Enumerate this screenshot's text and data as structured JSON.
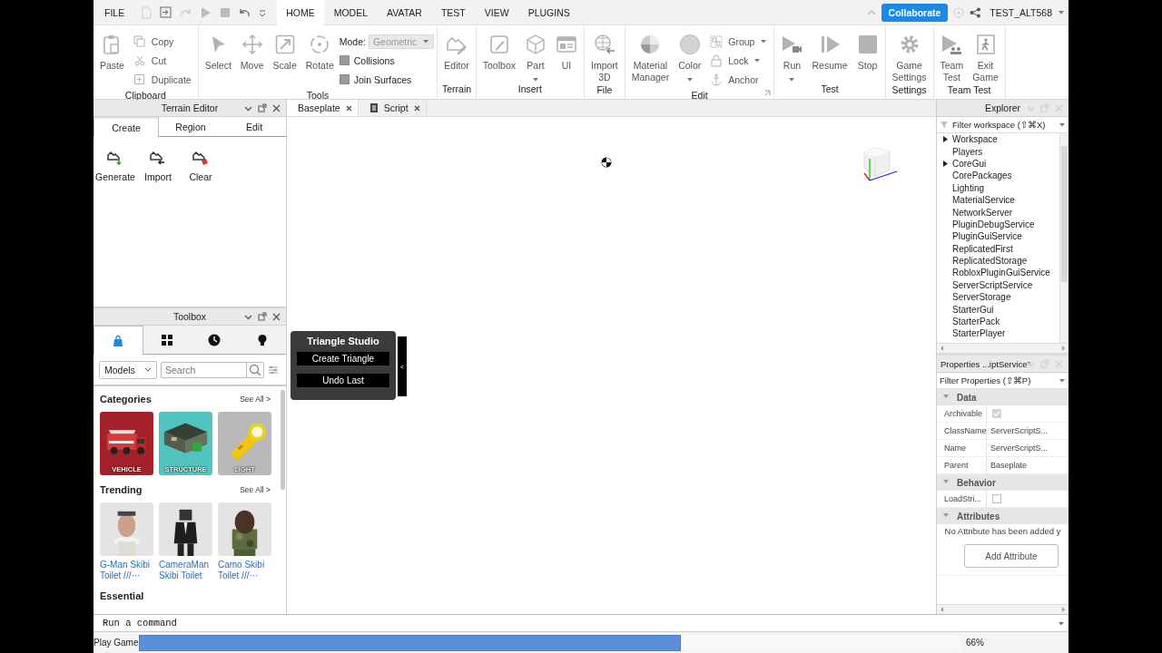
{
  "menu": {
    "file": "FILE",
    "tabs": [
      {
        "label": "HOME",
        "selected": true
      },
      {
        "label": "MODEL",
        "selected": false
      },
      {
        "label": "AVATAR",
        "selected": false
      },
      {
        "label": "TEST",
        "selected": false
      },
      {
        "label": "VIEW",
        "selected": false
      },
      {
        "label": "PLUGINS",
        "selected": false
      }
    ],
    "collaborate": "Collaborate",
    "user": "TEST_ALT568"
  },
  "ribbon": [
    {
      "label": "Clipboard",
      "launcher": false,
      "tools": [
        {
          "kind": "large",
          "label": "Paste",
          "dropdown": false
        },
        {
          "kind": "small",
          "label": "Copy",
          "dropdown": false
        },
        {
          "kind": "small",
          "label": "Cut",
          "dropdown": false
        },
        {
          "kind": "small",
          "label": "Duplicate",
          "dropdown": false
        }
      ]
    },
    {
      "label": "Tools",
      "launcher": false,
      "tools": [
        {
          "kind": "large",
          "label": "Select",
          "dropdown": false
        },
        {
          "kind": "large",
          "label": "Move",
          "dropdown": false
        },
        {
          "kind": "large",
          "label": "Scale",
          "dropdown": false
        },
        {
          "kind": "large",
          "label": "Rotate",
          "dropdown": false
        },
        {
          "kind": "select",
          "label": "Mode:",
          "value": "Geometric"
        },
        {
          "kind": "check",
          "label": "Collisions",
          "checked": false
        },
        {
          "kind": "check",
          "label": "Join Surfaces",
          "checked": false
        }
      ]
    },
    {
      "label": "Terrain",
      "launcher": false,
      "tools": [
        {
          "kind": "large",
          "label": "Editor",
          "dropdown": false
        }
      ]
    },
    {
      "label": "Insert",
      "launcher": false,
      "tools": [
        {
          "kind": "large",
          "label": "Toolbox",
          "dropdown": false
        },
        {
          "kind": "large",
          "label": "Part",
          "dropdown": true
        },
        {
          "kind": "large",
          "label": "UI",
          "dropdown": false
        }
      ]
    },
    {
      "label": "File",
      "launcher": false,
      "tools": [
        {
          "kind": "large",
          "label": "Import 3D",
          "dropdown": false
        }
      ]
    },
    {
      "label": "Edit",
      "launcher": true,
      "tools": [
        {
          "kind": "large",
          "label": "Material Manager",
          "dropdown": false
        },
        {
          "kind": "large",
          "label": "Color",
          "dropdown": true
        },
        {
          "kind": "small",
          "label": "Group",
          "dropdown": true
        },
        {
          "kind": "small",
          "label": "Lock",
          "dropdown": true
        },
        {
          "kind": "small",
          "label": "Anchor",
          "dropdown": false
        }
      ]
    },
    {
      "label": "Test",
      "launcher": false,
      "tools": [
        {
          "kind": "large",
          "label": "Run",
          "dropdown": true
        },
        {
          "kind": "large",
          "label": "Resume",
          "dropdown": false
        },
        {
          "kind": "large",
          "label": "Stop",
          "dropdown": false
        }
      ]
    },
    {
      "label": "Settings",
      "launcher": false,
      "tools": [
        {
          "kind": "large",
          "label": "Game Settings",
          "dropdown": false
        }
      ]
    },
    {
      "label": "Team Test",
      "launcher": false,
      "tools": [
        {
          "kind": "large",
          "label": "Team Test",
          "dropdown": false
        },
        {
          "kind": "large",
          "label": "Exit Game",
          "dropdown": false
        }
      ]
    }
  ],
  "terrain": {
    "title": "Terrain Editor",
    "tabs": [
      {
        "label": "Create",
        "selected": true
      },
      {
        "label": "Region",
        "selected": false
      },
      {
        "label": "Edit",
        "selected": false
      }
    ],
    "tools": [
      "Generate",
      "Import",
      "Clear"
    ]
  },
  "toolbox": {
    "title": "Toolbox",
    "tabs": [
      {
        "selected": true
      },
      {
        "selected": false
      },
      {
        "selected": false
      },
      {
        "selected": false
      }
    ],
    "category": "Models",
    "search_placeholder": "Search",
    "sections": [
      {
        "kind": "categories",
        "title": "Categories",
        "see_all": "See All >",
        "items": [
          {
            "label": "VEHICLE",
            "color": "#a3212a"
          },
          {
            "label": "STRUCTURE",
            "color": "#52c4bf"
          },
          {
            "label": "LIGHT",
            "color": "#b9b9b9"
          }
        ]
      },
      {
        "kind": "assets",
        "title": "Trending",
        "see_all": "See All >",
        "items": [
          {
            "name": "G-Man Skibi Toilet ///···"
          },
          {
            "name": "CameraMan Skibi Toilet"
          },
          {
            "name": "Camo Skibi Toilet ///···"
          }
        ]
      },
      {
        "kind": "heading",
        "title": "Essential"
      }
    ]
  },
  "viewport": {
    "tabs": [
      {
        "label": "Baseplate",
        "selected": true
      },
      {
        "label": "Script",
        "selected": false
      }
    ],
    "plugin": {
      "title": "Triangle Studio",
      "buttons": [
        "Create Triangle",
        "Undo Last"
      ],
      "toggle": "<"
    }
  },
  "explorer": {
    "title": "Explorer",
    "filter_placeholder": "Filter workspace (⇧⌘X)",
    "items": [
      {
        "label": "Workspace",
        "expandable": true
      },
      {
        "label": "Players",
        "expandable": false
      },
      {
        "label": "CoreGui",
        "expandable": true
      },
      {
        "label": "CorePackages",
        "expandable": false
      },
      {
        "label": "Lighting",
        "expandable": false
      },
      {
        "label": "MaterialService",
        "expandable": false
      },
      {
        "label": "NetworkServer",
        "expandable": false
      },
      {
        "label": "PluginDebugService",
        "expandable": false
      },
      {
        "label": "PluginGuiService",
        "expandable": false
      },
      {
        "label": "ReplicatedFirst",
        "expandable": false
      },
      {
        "label": "ReplicatedStorage",
        "expandable": false
      },
      {
        "label": "RobloxPluginGuiService",
        "expandable": false
      },
      {
        "label": "ServerScriptService",
        "expandable": false
      },
      {
        "label": "ServerStorage",
        "expandable": false
      },
      {
        "label": "StarterGui",
        "expandable": false
      },
      {
        "label": "StarterPack",
        "expandable": false
      },
      {
        "label": "StarterPlayer",
        "expandable": false
      }
    ]
  },
  "properties": {
    "title": "Properties ...iptService\"",
    "filter_placeholder": "Filter Properties (⇧⌘P)",
    "sections": [
      {
        "title": "Data",
        "expanded": true,
        "rows": [
          {
            "kind": "check",
            "name": "Archivable",
            "checked": true
          },
          {
            "kind": "text",
            "name": "ClassName",
            "value": "ServerScriptS..."
          },
          {
            "kind": "text",
            "name": "Name",
            "value": "ServerScriptS..."
          },
          {
            "kind": "text",
            "name": "Parent",
            "value": "Baseplate"
          }
        ]
      },
      {
        "title": "Behavior",
        "expanded": true,
        "rows": [
          {
            "kind": "check",
            "name": "LoadStri...",
            "checked": false
          }
        ]
      },
      {
        "title": "Attributes",
        "expanded": true,
        "note": "No Attribute has been added y",
        "button": "Add Attribute"
      }
    ]
  },
  "command": {
    "placeholder": "Run a command"
  },
  "status": {
    "label": "Play Game",
    "level": 0.66,
    "reading": "66%"
  }
}
